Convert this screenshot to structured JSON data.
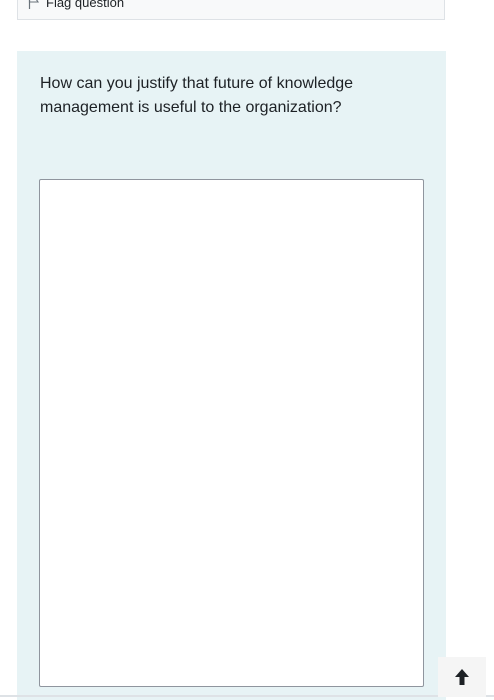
{
  "info": {
    "flag_label": "Flag question"
  },
  "question": {
    "text": "How can you justify that future of knowledge management is useful to the organization?",
    "answer_value": ""
  },
  "icons": {
    "flag": "flag-icon",
    "back_to_top": "arrow-up-icon"
  },
  "colors": {
    "panel_bg": "#e7f3f5",
    "text": "#1d2125",
    "border": "#8f959e"
  }
}
